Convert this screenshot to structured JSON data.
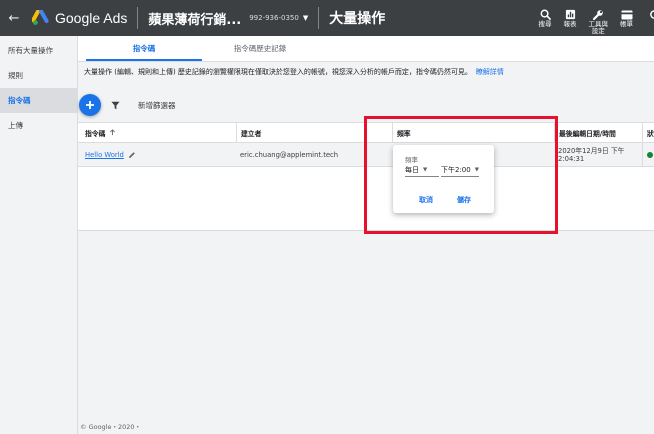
{
  "header": {
    "back_icon": "arrow-left-icon",
    "brand": "Google Ads",
    "account_name": "蘋果薄荷行銷...",
    "account_id": "992-936-0350",
    "page_title": "大量操作",
    "actions": [
      {
        "icon": "search-icon",
        "label": "搜尋"
      },
      {
        "icon": "reports-icon",
        "label": "報表"
      },
      {
        "icon": "wrench-icon",
        "label": "工具與\n設定"
      },
      {
        "icon": "billing-icon",
        "label": "帳單"
      }
    ]
  },
  "sidebar": {
    "items": [
      {
        "label": "所有大量操作"
      },
      {
        "label": "規則"
      },
      {
        "label": "指令碼"
      },
      {
        "label": "上傳"
      }
    ]
  },
  "tabs": [
    {
      "label": "指令碼"
    },
    {
      "label": "指令碼歷史記錄"
    }
  ],
  "notice": {
    "text": "大量操作 (編輯、規則和上傳) 歷史記錄的瀏覽權限現在僅取決於您登入的帳號，視您深入分析的帳戶而定，指令碼仍然可見。",
    "link": "瞭解詳情"
  },
  "toolbar": {
    "add_icon": "plus-icon",
    "filter_icon": "filter-icon",
    "add_filter": "新增篩選器"
  },
  "table": {
    "columns": [
      "指令碼",
      "建立者",
      "頻率",
      "最後編輯日期/時間",
      "狀"
    ],
    "sort_icon": "arrow-up-icon",
    "rows": [
      {
        "name": "Hello World",
        "creator": "eric.chuang@applemint.tech",
        "last_edit_line1": "2020年12月9日 下午",
        "last_edit_line2": "2:04:31",
        "status_color": "#188038"
      }
    ]
  },
  "frequency_popover": {
    "label": "頻率",
    "period": "每日",
    "time": "下午2:00",
    "cancel": "取消",
    "save": "儲存"
  },
  "footer": "© Google・2020・",
  "colors": {
    "accent": "#1a73e8",
    "topbar": "#3c4043",
    "highlight": "#e8112d"
  }
}
